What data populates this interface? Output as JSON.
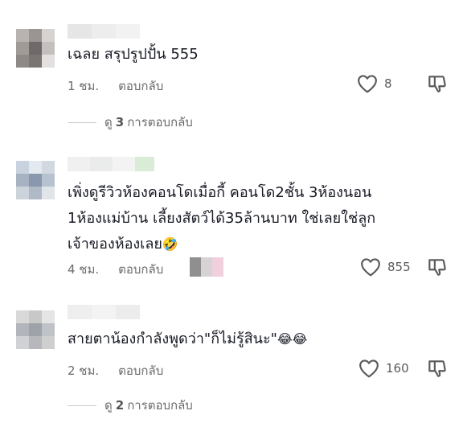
{
  "comments": [
    {
      "text_lines": [
        "เฉลย สรุปรูปปั้น 555"
      ],
      "time": "1 ชม.",
      "reply_label": "ตอบกลับ",
      "likes": "8",
      "view_replies": {
        "prefix": "ดู",
        "count": "3",
        "suffix": "การตอบกลับ"
      }
    },
    {
      "text_lines": [
        "เพิ่งดูรีวิวห้องคอนโดเมื่อกี้ คอนโด2ชั้น 3ห้องนอน",
        "1ห้องแม่บ้าน เลี้ยงสัตว์ได้35ล้านบาท ใช่เลยใช่ลูก",
        "เจ้าของห้องเลย"
      ],
      "emoji": "🤣",
      "time": "4 ชม.",
      "reply_label": "ตอบกลับ",
      "likes": "855"
    },
    {
      "text_lines": [
        "สายตาน้องกำลังพูดว่า\"ก็ไม่รู้สินะ\""
      ],
      "emoji": "😂😂",
      "time": "2 ชม.",
      "reply_label": "ตอบกลับ",
      "likes": "160",
      "view_replies": {
        "prefix": "ดู",
        "count": "2",
        "suffix": "การตอบกลับ"
      }
    }
  ],
  "icons": {
    "like": "heart-outline-icon",
    "dislike": "thumbs-down-outline-icon"
  },
  "colors": {
    "text": "#161823",
    "meta": "#6b6b6b",
    "icon": "#5a5a5a"
  }
}
